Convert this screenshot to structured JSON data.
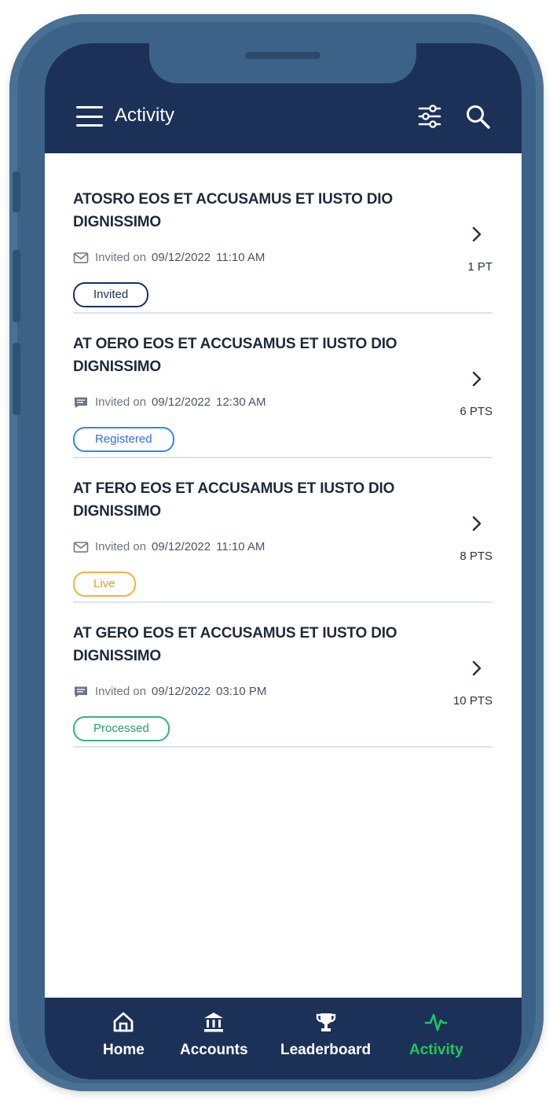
{
  "header": {
    "title": "Activity",
    "icons": [
      "menu-icon",
      "filter-sliders-icon",
      "search-icon"
    ]
  },
  "activities": [
    {
      "name": "ATOSRO EOS ET ACCUSAMUS ET IUSTO DIO DIGNISSIMO",
      "invited_label": "Invited on",
      "date": "09/12/2022",
      "time": "11:10 AM",
      "method_icon": "mail-icon",
      "status": "Invited",
      "status_color": "#1b3158",
      "points": "1 PT"
    },
    {
      "name": "AT OERO EOS ET ACCUSAMUS ET IUSTO DIO DIGNISSIMO",
      "invited_label": "Invited on",
      "date": "09/12/2022",
      "time": "12:30 AM",
      "method_icon": "message-icon",
      "status": "Registered",
      "status_color": "#3b82f6",
      "points": "6 PTS"
    },
    {
      "name": "AT FERO EOS ET ACCUSAMUS ET IUSTO DIO DIGNISSIMO",
      "invited_label": "Invited on",
      "date": "09/12/2022",
      "time": "11:10 AM",
      "method_icon": "mail-icon",
      "status": "Live",
      "status_color": "#f3b33d",
      "points": "8 PTS"
    },
    {
      "name": "AT GERO EOS ET ACCUSAMUS ET IUSTO DIO DIGNISSIMO",
      "invited_label": "Invited on",
      "date": "09/12/2022",
      "time": "03:10 PM",
      "method_icon": "message-icon",
      "status": "Processed",
      "status_color": "#37b37b",
      "points": "10 PTS"
    }
  ],
  "tabbar": {
    "tabs": [
      {
        "label": "Home",
        "icon": "home-icon"
      },
      {
        "label": "Accounts",
        "icon": "bank-icon"
      },
      {
        "label": "Leaderboard",
        "icon": "trophy-icon"
      },
      {
        "label": "Activity",
        "icon": "activity-pulse-icon",
        "active": true
      }
    ],
    "active_color": "#22c55e",
    "background": "#1b3158"
  }
}
